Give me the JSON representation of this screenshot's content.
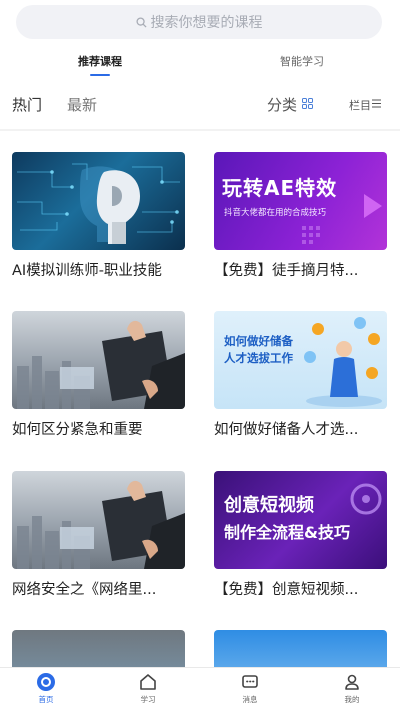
{
  "search": {
    "placeholder": "搜索你想要的课程"
  },
  "tabs": [
    {
      "label": "推荐课程",
      "active": true
    },
    {
      "label": "智能学习",
      "active": false
    }
  ],
  "filters": {
    "hot": "热门",
    "latest": "最新",
    "category": "分类",
    "column": "栏目"
  },
  "courses": [
    {
      "title": "AI模拟训练师-职业技能",
      "thumb_text": ""
    },
    {
      "title": "【免费】徒手摘月特...",
      "thumb_text": "玩转AE特效",
      "thumb_sub": "抖音大佬都在用的合成技巧"
    },
    {
      "title": "如何区分紧急和重要",
      "thumb_text": ""
    },
    {
      "title": "如何做好储备人才选...",
      "thumb_text": "如何做好储备",
      "thumb_text2": "人才选拔工作"
    },
    {
      "title": "网络安全之《网络里...",
      "thumb_text": ""
    },
    {
      "title": "【免费】创意短视频...",
      "thumb_text": "创意短视频",
      "thumb_text2": "制作全流程&技巧"
    }
  ],
  "tabbar": [
    {
      "label": "首页",
      "icon": "home-circle-icon",
      "active": true
    },
    {
      "label": "学习",
      "icon": "house-icon",
      "active": false
    },
    {
      "label": "消息",
      "icon": "message-icon",
      "active": false
    },
    {
      "label": "我的",
      "icon": "user-icon",
      "active": false
    }
  ],
  "colors": {
    "accent": "#2b6be6"
  }
}
